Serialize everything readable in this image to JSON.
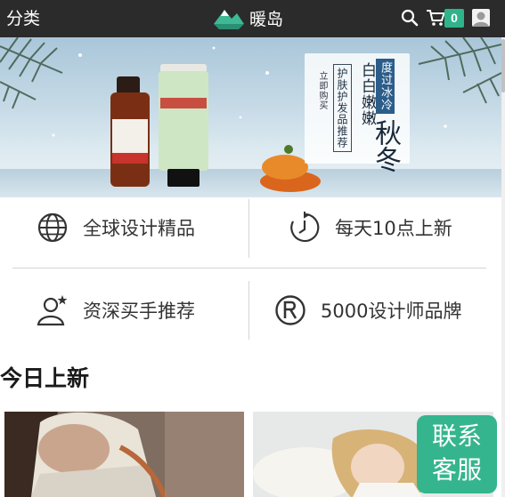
{
  "header": {
    "category_label": "分类",
    "brand_name": "暖岛",
    "cart_count": "0"
  },
  "banner": {
    "buy_now": "立即购买",
    "skin_care": "护肤护发品推荐",
    "tender": "白白嫩嫩",
    "winter": "度过冰冷",
    "season": "秋冬"
  },
  "features": [
    {
      "label": "全球设计精品",
      "icon": "globe-icon"
    },
    {
      "label": "每天10点上新",
      "icon": "clock-refresh-icon"
    },
    {
      "label": "资深买手推荐",
      "icon": "user-star-icon"
    },
    {
      "label": "5000设计师品牌",
      "icon": "registered-icon"
    }
  ],
  "section": {
    "title": "今日上新"
  },
  "service": {
    "line1": "联系",
    "line2": "客服"
  },
  "colors": {
    "header_bg": "#2b2b2b",
    "accent": "#2fb38a",
    "service_bg": "#35b58d"
  }
}
